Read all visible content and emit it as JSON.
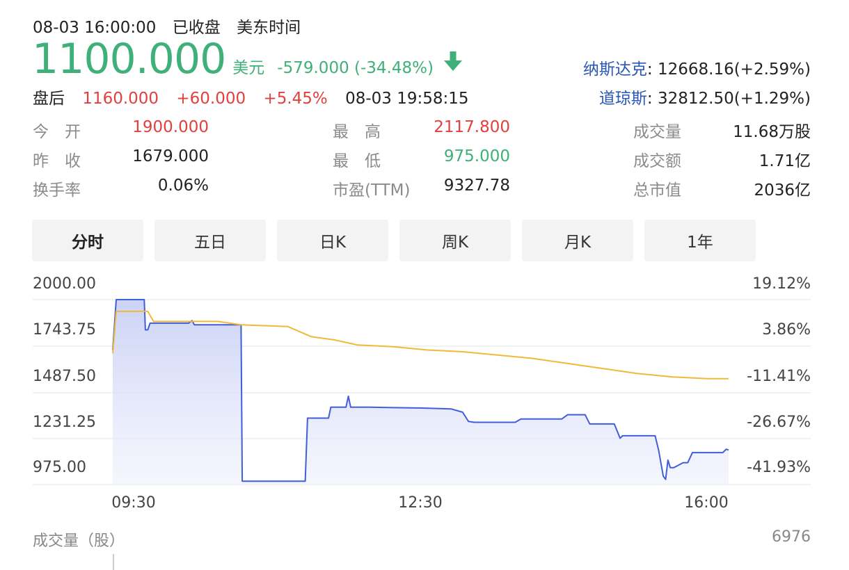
{
  "header": {
    "datetime": "08-03 16:00:00",
    "market_status": "已收盘",
    "timezone": "美东时间"
  },
  "quote": {
    "price": "1100.000",
    "currency": "美元",
    "change": "-579.000 (-34.48%)",
    "direction_icon": "arrow-down-icon"
  },
  "after_hours": {
    "label": "盘后",
    "price": "1160.000",
    "change": "+60.000",
    "percent": "+5.45%",
    "time": "08-03 19:58:15"
  },
  "indices": [
    {
      "name": "纳斯达克",
      "sep": ":",
      "value": " 12668.16(+2.59%)"
    },
    {
      "name": "道琼斯",
      "sep": ":",
      "value": " 32812.50(+1.29%)"
    }
  ],
  "stats": {
    "col1": [
      {
        "label": "今　开",
        "value": "1900.000",
        "color": "red"
      },
      {
        "label": "昨　收",
        "value": "1679.000",
        "color": "normal"
      },
      {
        "label": "换手率",
        "value": "0.06%",
        "color": "normal"
      }
    ],
    "col2": [
      {
        "label": "最　高",
        "value": "2117.800",
        "color": "red"
      },
      {
        "label": "最　低",
        "value": "975.000",
        "color": "green"
      },
      {
        "label": "市盈(TTM)",
        "value": "9327.78",
        "color": "normal"
      }
    ],
    "col3": [
      {
        "label": "成交量",
        "value": "11.68万股",
        "color": "normal"
      },
      {
        "label": "成交额",
        "value": "1.71亿",
        "color": "normal"
      },
      {
        "label": "总市值",
        "value": "2036亿",
        "color": "normal"
      }
    ]
  },
  "tabs": [
    {
      "label": "分时",
      "active": true
    },
    {
      "label": "五日",
      "active": false
    },
    {
      "label": "日K",
      "active": false
    },
    {
      "label": "周K",
      "active": false
    },
    {
      "label": "月K",
      "active": false
    },
    {
      "label": "1年",
      "active": false
    }
  ],
  "chart_data": {
    "type": "line",
    "title": "",
    "xlabel": "",
    "ylabel": "",
    "y_ticks": [
      "2000.00",
      "1743.75",
      "1487.50",
      "1231.25",
      "975.00"
    ],
    "y_tick_values": [
      2000.0,
      1743.75,
      1487.5,
      1231.25,
      975.0
    ],
    "pct_ticks": [
      "19.12%",
      "3.86%",
      "-11.41%",
      "-26.67%",
      "-41.93%"
    ],
    "x_ticks": [
      "09:30",
      "12:30",
      "16:00"
    ],
    "ylim": [
      900,
      2000
    ],
    "grid": true,
    "series": [
      {
        "name": "",
        "color": "#3f5fd8",
        "fill": true,
        "points": [
          [
            "09:30",
            1700
          ],
          [
            "09:33",
            2000
          ],
          [
            "09:57",
            2000
          ],
          [
            "09:58",
            1820
          ],
          [
            "10:00",
            1820
          ],
          [
            "10:02",
            1860
          ],
          [
            "10:35",
            1860
          ],
          [
            "10:38",
            1875
          ],
          [
            "10:40",
            1850
          ],
          [
            "11:20",
            1850
          ],
          [
            "11:21",
            920
          ],
          [
            "12:15",
            920
          ],
          [
            "12:17",
            1295
          ],
          [
            "12:35",
            1295
          ],
          [
            "12:37",
            1360
          ],
          [
            "12:50",
            1360
          ],
          [
            "12:52",
            1425
          ],
          [
            "12:54",
            1360
          ],
          [
            "13:10",
            1360
          ],
          [
            "13:25",
            1358
          ],
          [
            "13:55",
            1355
          ],
          [
            "14:20",
            1350
          ],
          [
            "14:30",
            1330
          ],
          [
            "14:35",
            1275
          ],
          [
            "14:40",
            1270
          ],
          [
            "15:15",
            1270
          ],
          [
            "15:20",
            1290
          ],
          [
            "15:55",
            1290
          ],
          [
            "16:00",
            1315
          ],
          [
            "16:15",
            1315
          ],
          [
            "16:19",
            1260
          ],
          [
            "16:40",
            1260
          ],
          [
            "16:45",
            1175
          ],
          [
            "16:47",
            1190
          ],
          [
            "17:15",
            1190
          ],
          [
            "17:18",
            1105
          ],
          [
            "17:22",
            950
          ],
          [
            "17:24",
            930
          ],
          [
            "17:26",
            1045
          ],
          [
            "17:28",
            1000
          ],
          [
            "17:31",
            1000
          ],
          [
            "17:39",
            1030
          ],
          [
            "17:43",
            1030
          ],
          [
            "17:47",
            1090
          ],
          [
            "18:13",
            1090
          ],
          [
            "18:16",
            1110
          ],
          [
            "18:18",
            1105
          ]
        ]
      },
      {
        "name": "",
        "color": "#f0b93a",
        "fill": false,
        "points": [
          [
            "09:30",
            1680
          ],
          [
            "09:33",
            1930
          ],
          [
            "10:00",
            1930
          ],
          [
            "10:05",
            1870
          ],
          [
            "11:00",
            1870
          ],
          [
            "11:20",
            1850
          ],
          [
            "12:00",
            1840
          ],
          [
            "12:20",
            1780
          ],
          [
            "12:40",
            1760
          ],
          [
            "13:00",
            1730
          ],
          [
            "13:30",
            1720
          ],
          [
            "14:00",
            1700
          ],
          [
            "14:30",
            1690
          ],
          [
            "15:00",
            1670
          ],
          [
            "15:30",
            1650
          ],
          [
            "16:00",
            1620
          ],
          [
            "16:30",
            1590
          ],
          [
            "17:00",
            1560
          ],
          [
            "17:30",
            1540
          ],
          [
            "18:00",
            1530
          ],
          [
            "18:18",
            1530
          ]
        ]
      }
    ]
  },
  "volume": {
    "label": "成交量（股）",
    "max": "6976"
  }
}
